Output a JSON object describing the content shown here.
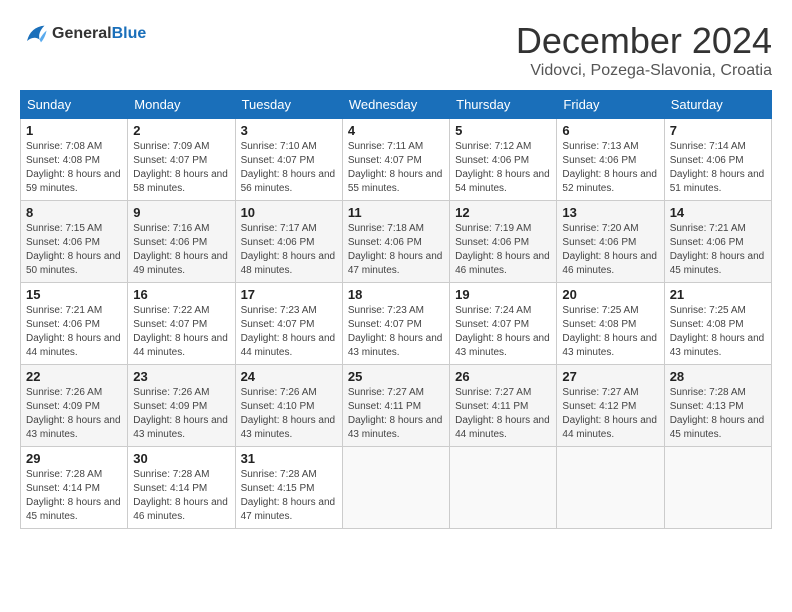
{
  "header": {
    "logo_general": "General",
    "logo_blue": "Blue",
    "month_title": "December 2024",
    "location": "Vidovci, Pozega-Slavonia, Croatia"
  },
  "weekdays": [
    "Sunday",
    "Monday",
    "Tuesday",
    "Wednesday",
    "Thursday",
    "Friday",
    "Saturday"
  ],
  "weeks": [
    [
      {
        "day": 1,
        "sunrise": "7:08 AM",
        "sunset": "4:08 PM",
        "daylight": "8 hours and 59 minutes."
      },
      {
        "day": 2,
        "sunrise": "7:09 AM",
        "sunset": "4:07 PM",
        "daylight": "8 hours and 58 minutes."
      },
      {
        "day": 3,
        "sunrise": "7:10 AM",
        "sunset": "4:07 PM",
        "daylight": "8 hours and 56 minutes."
      },
      {
        "day": 4,
        "sunrise": "7:11 AM",
        "sunset": "4:07 PM",
        "daylight": "8 hours and 55 minutes."
      },
      {
        "day": 5,
        "sunrise": "7:12 AM",
        "sunset": "4:06 PM",
        "daylight": "8 hours and 54 minutes."
      },
      {
        "day": 6,
        "sunrise": "7:13 AM",
        "sunset": "4:06 PM",
        "daylight": "8 hours and 52 minutes."
      },
      {
        "day": 7,
        "sunrise": "7:14 AM",
        "sunset": "4:06 PM",
        "daylight": "8 hours and 51 minutes."
      }
    ],
    [
      {
        "day": 8,
        "sunrise": "7:15 AM",
        "sunset": "4:06 PM",
        "daylight": "8 hours and 50 minutes."
      },
      {
        "day": 9,
        "sunrise": "7:16 AM",
        "sunset": "4:06 PM",
        "daylight": "8 hours and 49 minutes."
      },
      {
        "day": 10,
        "sunrise": "7:17 AM",
        "sunset": "4:06 PM",
        "daylight": "8 hours and 48 minutes."
      },
      {
        "day": 11,
        "sunrise": "7:18 AM",
        "sunset": "4:06 PM",
        "daylight": "8 hours and 47 minutes."
      },
      {
        "day": 12,
        "sunrise": "7:19 AM",
        "sunset": "4:06 PM",
        "daylight": "8 hours and 46 minutes."
      },
      {
        "day": 13,
        "sunrise": "7:20 AM",
        "sunset": "4:06 PM",
        "daylight": "8 hours and 46 minutes."
      },
      {
        "day": 14,
        "sunrise": "7:21 AM",
        "sunset": "4:06 PM",
        "daylight": "8 hours and 45 minutes."
      }
    ],
    [
      {
        "day": 15,
        "sunrise": "7:21 AM",
        "sunset": "4:06 PM",
        "daylight": "8 hours and 44 minutes."
      },
      {
        "day": 16,
        "sunrise": "7:22 AM",
        "sunset": "4:07 PM",
        "daylight": "8 hours and 44 minutes."
      },
      {
        "day": 17,
        "sunrise": "7:23 AM",
        "sunset": "4:07 PM",
        "daylight": "8 hours and 44 minutes."
      },
      {
        "day": 18,
        "sunrise": "7:23 AM",
        "sunset": "4:07 PM",
        "daylight": "8 hours and 43 minutes."
      },
      {
        "day": 19,
        "sunrise": "7:24 AM",
        "sunset": "4:07 PM",
        "daylight": "8 hours and 43 minutes."
      },
      {
        "day": 20,
        "sunrise": "7:25 AM",
        "sunset": "4:08 PM",
        "daylight": "8 hours and 43 minutes."
      },
      {
        "day": 21,
        "sunrise": "7:25 AM",
        "sunset": "4:08 PM",
        "daylight": "8 hours and 43 minutes."
      }
    ],
    [
      {
        "day": 22,
        "sunrise": "7:26 AM",
        "sunset": "4:09 PM",
        "daylight": "8 hours and 43 minutes."
      },
      {
        "day": 23,
        "sunrise": "7:26 AM",
        "sunset": "4:09 PM",
        "daylight": "8 hours and 43 minutes."
      },
      {
        "day": 24,
        "sunrise": "7:26 AM",
        "sunset": "4:10 PM",
        "daylight": "8 hours and 43 minutes."
      },
      {
        "day": 25,
        "sunrise": "7:27 AM",
        "sunset": "4:11 PM",
        "daylight": "8 hours and 43 minutes."
      },
      {
        "day": 26,
        "sunrise": "7:27 AM",
        "sunset": "4:11 PM",
        "daylight": "8 hours and 44 minutes."
      },
      {
        "day": 27,
        "sunrise": "7:27 AM",
        "sunset": "4:12 PM",
        "daylight": "8 hours and 44 minutes."
      },
      {
        "day": 28,
        "sunrise": "7:28 AM",
        "sunset": "4:13 PM",
        "daylight": "8 hours and 45 minutes."
      }
    ],
    [
      {
        "day": 29,
        "sunrise": "7:28 AM",
        "sunset": "4:14 PM",
        "daylight": "8 hours and 45 minutes."
      },
      {
        "day": 30,
        "sunrise": "7:28 AM",
        "sunset": "4:14 PM",
        "daylight": "8 hours and 46 minutes."
      },
      {
        "day": 31,
        "sunrise": "7:28 AM",
        "sunset": "4:15 PM",
        "daylight": "8 hours and 47 minutes."
      },
      null,
      null,
      null,
      null
    ]
  ]
}
